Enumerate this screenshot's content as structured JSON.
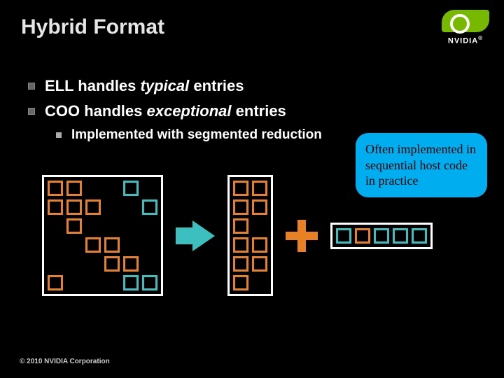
{
  "title": "Hybrid Format",
  "logo": {
    "brand": "NVIDIA",
    "reg": "®"
  },
  "bullets": {
    "b1_prefix": "ELL handles ",
    "b1_em": "typical",
    "b1_suffix": " entries",
    "b2_prefix": "COO handles ",
    "b2_em": "exceptional",
    "b2_suffix": " entries",
    "sub1": "Implemented with segmented reduction"
  },
  "callout": "Often implemented in sequential host code in practice",
  "copyright": "© 2010 NVIDIA Corporation",
  "diagram": {
    "source_matrix": [
      [
        "o",
        "o",
        "e",
        "e",
        "t",
        "e"
      ],
      [
        "o",
        "o",
        "o",
        "e",
        "e",
        "t"
      ],
      [
        "e",
        "o",
        "e",
        "e",
        "e",
        "e"
      ],
      [
        "e",
        "e",
        "o",
        "o",
        "e",
        "e"
      ],
      [
        "e",
        "e",
        "e",
        "o",
        "o",
        "e"
      ],
      [
        "o",
        "e",
        "e",
        "e",
        "t",
        "t"
      ]
    ],
    "ell_matrix": [
      [
        "o",
        "o"
      ],
      [
        "o",
        "o"
      ],
      [
        "o",
        "e"
      ],
      [
        "o",
        "o"
      ],
      [
        "o",
        "o"
      ],
      [
        "o",
        "e"
      ]
    ],
    "coo_row": [
      "t",
      "o",
      "t",
      "t",
      "t"
    ],
    "colors": {
      "o": "#e88024",
      "t": "#3cbfbf",
      "frame": "#ffffff"
    }
  }
}
